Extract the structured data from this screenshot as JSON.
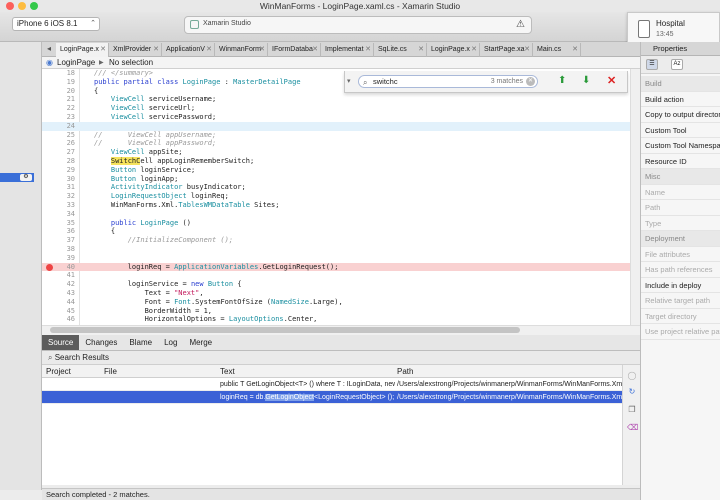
{
  "window": {
    "title": "WinManForms - LoginPage.xaml.cs - Xamarin Studio"
  },
  "toolbar": {
    "device": "iPhone 6 iOS 8.1",
    "status": "Xamarin Studio"
  },
  "notification": {
    "app": "Hospital",
    "time": "13:45"
  },
  "tabs": [
    {
      "label": "LoginPage.x",
      "active": true
    },
    {
      "label": "XmlProvider",
      "active": false
    },
    {
      "label": "ApplicationV",
      "active": false
    },
    {
      "label": "WinmanForm",
      "active": false
    },
    {
      "label": "IFormDataba",
      "active": false
    },
    {
      "label": "Implementat",
      "active": false
    },
    {
      "label": "SqLite.cs",
      "active": false
    },
    {
      "label": "LoginPage.x",
      "active": false
    },
    {
      "label": "StartPage.xa",
      "active": false
    },
    {
      "label": "Main.cs",
      "active": false
    }
  ],
  "breadcrumb": {
    "class": "LoginPage",
    "member": "No selection"
  },
  "find": {
    "query": "switchc",
    "matches": "3 matches"
  },
  "code": [
    {
      "n": "18",
      "html": "<span class='cm'>/// &lt;/summary&gt;</span>"
    },
    {
      "n": "19",
      "html": "<span class='kw'>public partial class</span> <span class='ty'>LoginPage</span> : <span class='ty'>MasterDetailPage</span>"
    },
    {
      "n": "20",
      "html": "{"
    },
    {
      "n": "21",
      "html": "    <span class='ty'>ViewCell</span> serviceUsername;"
    },
    {
      "n": "22",
      "html": "    <span class='ty'>ViewCell</span> serviceUrl;"
    },
    {
      "n": "23",
      "html": "    <span class='ty'>ViewCell</span> servicePassword;"
    },
    {
      "n": "24",
      "html": "",
      "cls": "cur"
    },
    {
      "n": "25",
      "html": "<span class='cm'>//      ViewCell appUsername;</span>"
    },
    {
      "n": "26",
      "html": "<span class='cm'>//      ViewCell appPassword;</span>"
    },
    {
      "n": "27",
      "html": "    <span class='ty'>ViewCell</span> appSite;"
    },
    {
      "n": "28",
      "html": "    <span class='hl'>SwitchC</span>ell appLoginRememberSwitch;"
    },
    {
      "n": "29",
      "html": "    <span class='ty'>Button</span> loginService;"
    },
    {
      "n": "30",
      "html": "    <span class='ty'>Button</span> loginApp;"
    },
    {
      "n": "31",
      "html": "    <span class='ty'>ActivityIndicator</span> busyIndicator;"
    },
    {
      "n": "32",
      "html": "    <span class='ty'>LoginRequestObject</span> loginReq;"
    },
    {
      "n": "33",
      "html": "    WinManForms.Xml.<span class='ty'>TablesWMDataTable</span> Sites;"
    },
    {
      "n": "34",
      "html": ""
    },
    {
      "n": "35",
      "html": "    <span class='kw'>public</span> <span class='ty'>LoginPage</span> ()"
    },
    {
      "n": "36",
      "html": "    {"
    },
    {
      "n": "37",
      "html": "        <span class='cm'>//InitializeComponent ();</span>"
    },
    {
      "n": "38",
      "html": ""
    },
    {
      "n": "39",
      "html": ""
    },
    {
      "n": "40",
      "html": "        loginReq = <span class='ty'>ApplicationVariables</span>.GetLoginRequest();",
      "cls": "bp"
    },
    {
      "n": "41",
      "html": ""
    },
    {
      "n": "42",
      "html": "        loginService = <span class='kw'>new</span> <span class='ty'>Button</span> {"
    },
    {
      "n": "43",
      "html": "            Text = <span class='st'>\"Next\"</span>,"
    },
    {
      "n": "44",
      "html": "            Font = <span class='ty'>Font</span>.SystemFontOfSize (<span class='ty'>NamedSize</span>.Large),"
    },
    {
      "n": "45",
      "html": "            BorderWidth = 1,"
    },
    {
      "n": "46",
      "html": "            HorizontalOptions = <span class='ty'>LayoutOptions</span>.Center,"
    }
  ],
  "vcs_tabs": [
    "Source",
    "Changes",
    "Blame",
    "Log",
    "Merge"
  ],
  "results": {
    "title": "Search Results",
    "columns": [
      "Project",
      "File",
      "Text",
      "Path"
    ],
    "rows": [
      {
        "project": "WinManFor...",
        "file": "IFormDatabase.cs:60",
        "text_pre": "public T GetLoginObject<T> () where T : ILoginData, new ()",
        "text_match": "",
        "text_post": "",
        "path": "/Users/alexstrong/Projects/winmanerp/WinmanForms/WinManForms.Xml.PCL"
      },
      {
        "project": "WinManFor...",
        "file": "ApplicationVariables.cs:101",
        "text_pre": "loginReq = db.",
        "text_match": "GetLoginObject",
        "text_post": "<LoginRequestObject> ();",
        "path": "/Users/alexstrong/Projects/winmanerp/WinmanForms/WinManForms.Xml.PCL"
      }
    ]
  },
  "status": "Search completed - 2 matches.",
  "properties": {
    "title": "Properties",
    "items": [
      {
        "label": "Build",
        "type": "cat"
      },
      {
        "label": "Build action",
        "type": "item"
      },
      {
        "label": "Copy to output directory",
        "type": "item"
      },
      {
        "label": "Custom Tool",
        "type": "item"
      },
      {
        "label": "Custom Tool Namespace",
        "type": "item"
      },
      {
        "label": "Resource ID",
        "type": "item"
      },
      {
        "label": "Misc",
        "type": "cat"
      },
      {
        "label": "Name",
        "type": "dim"
      },
      {
        "label": "Path",
        "type": "dim"
      },
      {
        "label": "Type",
        "type": "dim"
      },
      {
        "label": "Deployment",
        "type": "cat"
      },
      {
        "label": "File attributes",
        "type": "dim"
      },
      {
        "label": "Has path references",
        "type": "dim"
      },
      {
        "label": "Include in deploy",
        "type": "item"
      },
      {
        "label": "Relative target path",
        "type": "dim"
      },
      {
        "label": "Target directory",
        "type": "dim"
      },
      {
        "label": "Use project relative path",
        "type": "dim"
      }
    ]
  }
}
